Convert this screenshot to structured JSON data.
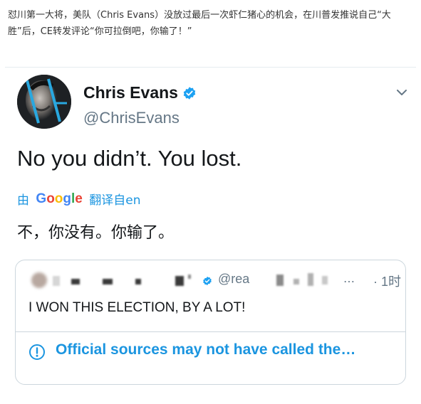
{
  "article": {
    "intro_text": "怼川第一大将，美队（Chris Evans）没放过最后一次虾仁猪心的机会，在川普发推说自己“大胜”后，CE转发评论“你可拉倒吧，你输了！”"
  },
  "tweet": {
    "display_name": "Chris Evans",
    "handle": "@ChrisEvans",
    "text": "No you didn’t. You lost.",
    "verified": true,
    "accent_color": "#1b95e0",
    "translation": {
      "by_label": "由",
      "google_letters": [
        "G",
        "o",
        "o",
        "g",
        "l",
        "e"
      ],
      "suffix_label": "翻译自en",
      "translated_text": "不，你没有。你输了。"
    }
  },
  "quoted_tweet": {
    "handle_partial": "@rea",
    "ellipsis": "…",
    "time": "· 1时",
    "text": "I WON THIS ELECTION, BY A LOT!",
    "notice": "Official sources may not have called the…",
    "notice_icon": "exclamation-circle-icon"
  }
}
